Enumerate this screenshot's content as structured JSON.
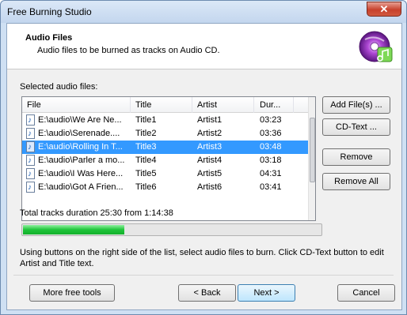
{
  "window": {
    "title": "Free Burning Studio",
    "close_label": "✕"
  },
  "header": {
    "title": "Audio Files",
    "subtitle": "Audio files to be burned as tracks on Audio CD."
  },
  "list": {
    "label": "Selected audio files:",
    "columns": [
      "File",
      "Title",
      "Artist",
      "Dur..."
    ],
    "rows": [
      {
        "file": "E:\\audio\\We Are Ne...",
        "title": "Title1",
        "artist": "Artist1",
        "duration": "03:23",
        "selected": false
      },
      {
        "file": "E:\\audio\\Serenade....",
        "title": "Title2",
        "artist": "Artist2",
        "duration": "03:36",
        "selected": false
      },
      {
        "file": "E:\\audio\\Rolling In T...",
        "title": "Title3",
        "artist": "Artist3",
        "duration": "03:48",
        "selected": true
      },
      {
        "file": "E:\\audio\\Parler a mo...",
        "title": "Title4",
        "artist": "Artist4",
        "duration": "03:18",
        "selected": false
      },
      {
        "file": "E:\\audio\\I Was Here...",
        "title": "Title5",
        "artist": "Artist5",
        "duration": "04:31",
        "selected": false
      },
      {
        "file": "E:\\audio\\Got A Frien...",
        "title": "Title6",
        "artist": "Artist6",
        "duration": "03:41",
        "selected": false
      }
    ]
  },
  "side_buttons": {
    "add": "Add File(s) ...",
    "cdtext": "CD-Text ...",
    "remove": "Remove",
    "remove_all": "Remove All"
  },
  "total": {
    "text": "Total tracks duration 25:30 from 1:14:38",
    "progress_fraction": 0.34
  },
  "hint": "Using buttons on the right side of the list, select audio files to burn. Click CD-Text button to edit Artist and Title text.",
  "footer": {
    "more_tools": "More free tools",
    "back": "< Back",
    "next": "Next >",
    "cancel": "Cancel"
  },
  "colors": {
    "selection": "#3399ff",
    "progress": "#1fc43a"
  }
}
